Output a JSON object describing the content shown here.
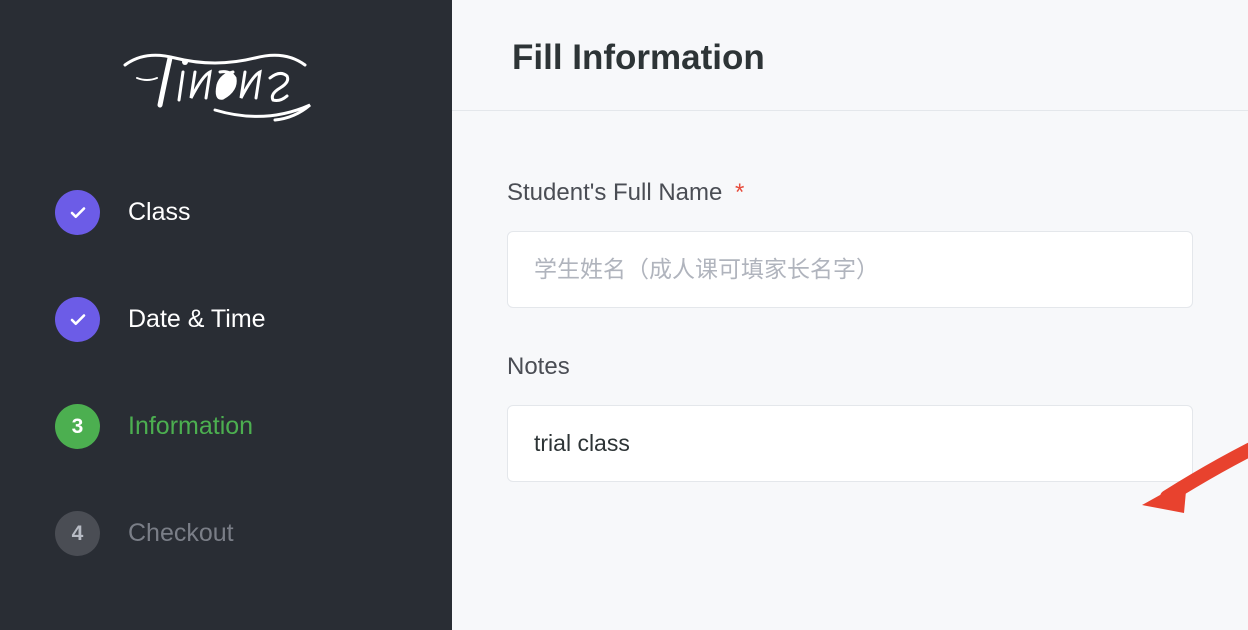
{
  "brand": {
    "name": "Tingna"
  },
  "sidebar": {
    "steps": [
      {
        "label": "Class",
        "status": "completed"
      },
      {
        "label": "Date & Time",
        "status": "completed"
      },
      {
        "label": "Information",
        "status": "active",
        "number": "3"
      },
      {
        "label": "Checkout",
        "status": "pending",
        "number": "4"
      }
    ]
  },
  "main": {
    "title": "Fill Information",
    "form": {
      "studentName": {
        "label": "Student's Full Name",
        "required": true,
        "placeholder": "学生姓名（成人课可填家长名字）",
        "value": ""
      },
      "notes": {
        "label": "Notes",
        "value": "trial class"
      }
    }
  }
}
